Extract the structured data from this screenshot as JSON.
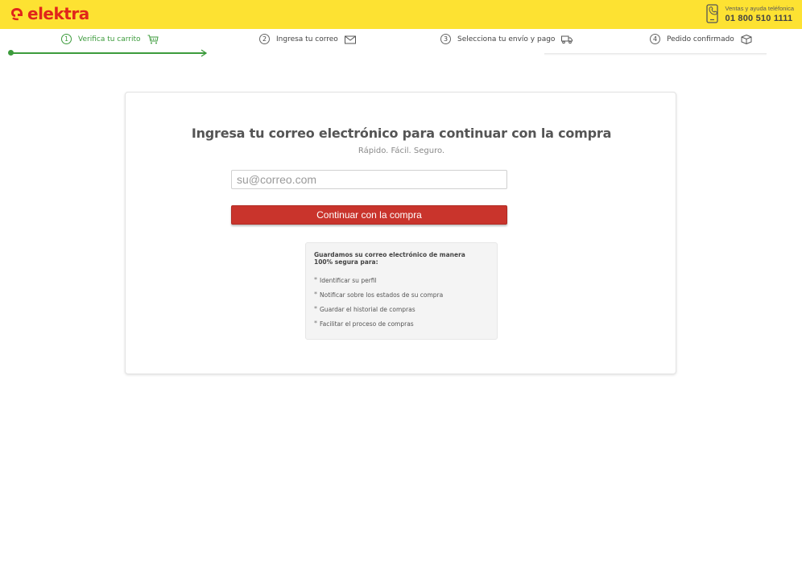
{
  "header": {
    "brand": "elektra",
    "phone_label": "Ventas y ayuda teléfonica",
    "phone_number": "01 800 510 1111"
  },
  "steps": [
    {
      "number": "1",
      "label": "Verifica tu carrito",
      "icon": "cart-icon",
      "active": true
    },
    {
      "number": "2",
      "label": "Ingresa tu correo",
      "icon": "envelope-icon",
      "active": false
    },
    {
      "number": "3",
      "label": "Selecciona tu envío y pago",
      "icon": "truck-icon",
      "active": false
    },
    {
      "number": "4",
      "label": "Pedido confirmado",
      "icon": "box-icon",
      "active": false
    }
  ],
  "form": {
    "title": "Ingresa tu correo electrónico para continuar con la compra",
    "subtitle": "Rápido. Fácil. Seguro.",
    "email_placeholder": "su@correo.com",
    "email_value": "",
    "submit_label": "Continuar con la compra"
  },
  "info": {
    "heading": "Guardamos su correo electrónico de manera 100% segura para:",
    "items": [
      "Identificar su perfil",
      "Notificar sobre los estados de su compra",
      "Guardar el historial de compras",
      "Facilitar el proceso de compras"
    ]
  },
  "colors": {
    "brand_red": "#e1251b",
    "header_yellow": "#fde232",
    "active_green": "#3c9b3c",
    "button_red": "#c9342c"
  }
}
